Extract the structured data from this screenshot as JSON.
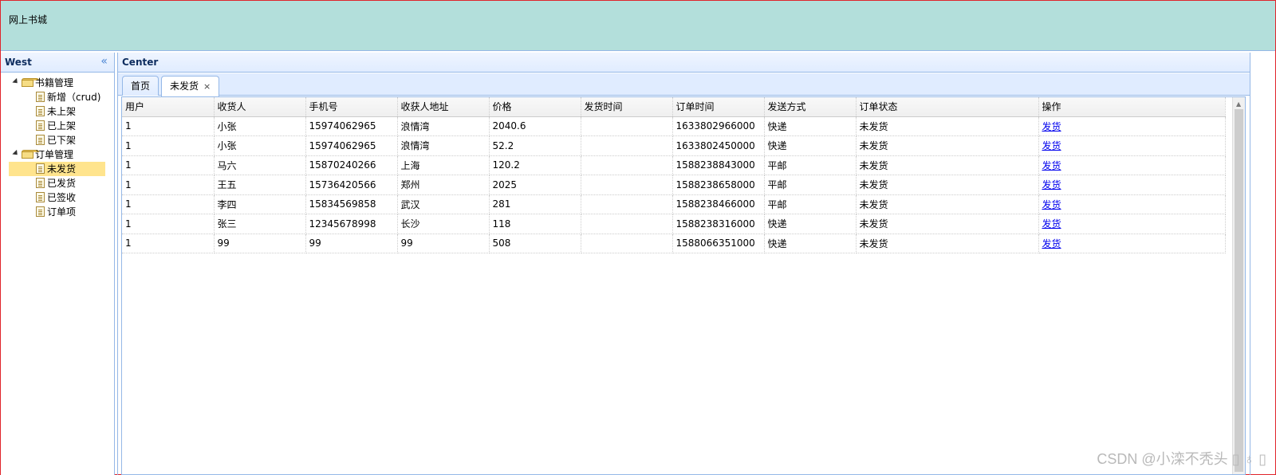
{
  "north": {
    "title": "网上书城"
  },
  "west": {
    "title": "West",
    "tree": [
      {
        "label": "书籍管理",
        "children": [
          "新增（crud)",
          "未上架",
          "已上架",
          "已下架"
        ]
      },
      {
        "label": "订单管理",
        "children": [
          "未发货",
          "已发货",
          "已签收",
          "订单项"
        ]
      }
    ]
  },
  "center": {
    "title": "Center",
    "tabs": [
      {
        "label": "首页"
      },
      {
        "label": "未发货",
        "close": "×"
      }
    ]
  },
  "grid": {
    "columns": [
      "用户",
      "收货人",
      "手机号",
      "收获人地址",
      "价格",
      "发货时间",
      "订单时间",
      "发送方式",
      "订单状态",
      "操作"
    ],
    "rows": [
      [
        "1",
        "小张",
        "15974062965",
        "浪情湾",
        "2040.6",
        "",
        "1633802966000",
        "快递",
        "未发货",
        "发货"
      ],
      [
        "1",
        "小张",
        "15974062965",
        "浪情湾",
        "52.2",
        "",
        "1633802450000",
        "快递",
        "未发货",
        "发货"
      ],
      [
        "1",
        "马六",
        "15870240266",
        "上海",
        "120.2",
        "",
        "1588238843000",
        "平邮",
        "未发货",
        "发货"
      ],
      [
        "1",
        "王五",
        "15736420566",
        "郑州",
        "2025",
        "",
        "1588238658000",
        "平邮",
        "未发货",
        "发货"
      ],
      [
        "1",
        "李四",
        "15834569858",
        "武汉",
        "281",
        "",
        "1588238466000",
        "平邮",
        "未发货",
        "发货"
      ],
      [
        "1",
        "张三",
        "12345678998",
        "长沙",
        "118",
        "",
        "1588238316000",
        "快递",
        "未发货",
        "发货"
      ],
      [
        "1",
        "99",
        "99",
        "99",
        "508",
        "",
        "1588066351000",
        "快递",
        "未发货",
        "发货"
      ]
    ]
  },
  "watermark": "CSDN @小滦不秃头 ▯ ♁ ▯",
  "colors": {
    "north_bg": "#b3dfdb",
    "selected": "#ffe48d",
    "border": "#95b8e7",
    "frame": "#e0242b"
  }
}
